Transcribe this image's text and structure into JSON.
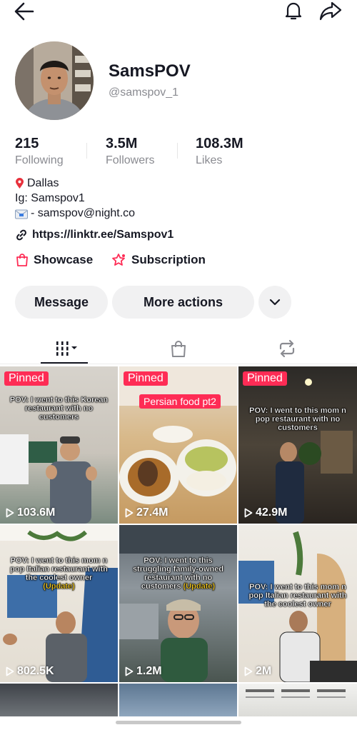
{
  "profile": {
    "display_name": "SamsPOV",
    "username": "@samspov_1"
  },
  "stats": {
    "following_count": "215",
    "following_label": "Following",
    "followers_count": "3.5M",
    "followers_label": "Followers",
    "likes_count": "108.3M",
    "likes_label": "Likes"
  },
  "bio": {
    "location": "Dallas",
    "instagram": "Ig: Samspov1",
    "email": "- samspov@night.co"
  },
  "link": {
    "url_text": "https://linktr.ee/Samspov1"
  },
  "features": {
    "showcase_label": "Showcase",
    "subscription_label": "Subscription"
  },
  "actions": {
    "message_label": "Message",
    "more_actions_label": "More actions"
  },
  "tabs": [
    {
      "icon": "videos-grid-icon",
      "active": true
    },
    {
      "icon": "shopping-bag-icon",
      "active": false
    },
    {
      "icon": "repost-icon",
      "active": false
    }
  ],
  "videos": [
    {
      "pinned_label": "Pinned",
      "caption": "POV: I went to this Korean restaurant with no customers",
      "views": "103.6M"
    },
    {
      "pinned_label": "Pinned",
      "tag": "Persian food pt2",
      "views": "27.4M"
    },
    {
      "pinned_label": "Pinned",
      "caption": "POV: I went to this mom n pop restaurant with no customers",
      "views": "42.9M"
    },
    {
      "caption": "POV: I went to this mom n pop Italian restaurant with the coolest owner",
      "update": "(Update)",
      "views": "802.5K"
    },
    {
      "caption": "POV: I went to this struggling family-owned restaurant with no customers",
      "update": "(Update)",
      "views": "1.2M"
    },
    {
      "caption": "POV: I went to this mom n pop Italian restaurant with the coolest owner",
      "views": "2M"
    }
  ],
  "colors": {
    "accent": "#fe2c55",
    "text_primary": "#161823",
    "text_secondary": "#8a8b91",
    "button_bg": "#f1f1f2"
  }
}
